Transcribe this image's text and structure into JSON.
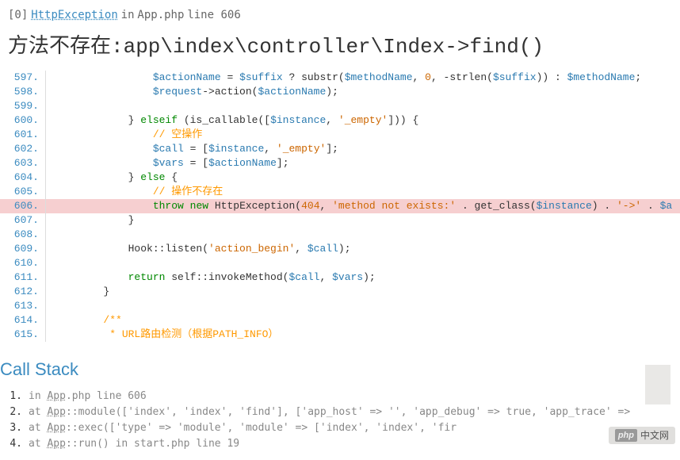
{
  "header": {
    "index": "[0]",
    "exception_class": "HttpException",
    "in": "in",
    "file": "App.php",
    "line_text": "line 606"
  },
  "title": "方法不存在:app\\index\\controller\\Index->find()",
  "code": {
    "lines": [
      {
        "n": "597.",
        "html": "                <span class='php-var'>$actionName</span> = <span class='php-var'>$suffix</span> ? substr(<span class='php-var'>$methodName</span>, <span class='php-number'>0</span>, -strlen(<span class='php-var'>$suffix</span>)) : <span class='php-var'>$methodName</span>;"
      },
      {
        "n": "598.",
        "html": "                <span class='php-var'>$request</span>-&gt;action(<span class='php-var'>$actionName</span>);"
      },
      {
        "n": "599.",
        "html": ""
      },
      {
        "n": "600.",
        "html": "            } <span class='php-keyword'>elseif</span> (is_callable([<span class='php-var'>$instance</span>, <span class='php-string'>'_empty'</span>])) {"
      },
      {
        "n": "601.",
        "html": "                <span class='php-comment'>// 空操作</span>"
      },
      {
        "n": "602.",
        "html": "                <span class='php-var'>$call</span> = [<span class='php-var'>$instance</span>, <span class='php-string'>'_empty'</span>];"
      },
      {
        "n": "603.",
        "html": "                <span class='php-var'>$vars</span> = [<span class='php-var'>$actionName</span>];"
      },
      {
        "n": "604.",
        "html": "            } <span class='php-keyword'>else</span> {"
      },
      {
        "n": "605.",
        "html": "                <span class='php-comment'>// 操作不存在</span>"
      },
      {
        "n": "606.",
        "hl": true,
        "html": "                <span class='php-keyword'>throw</span> <span class='php-keyword'>new</span> HttpException(<span class='php-number'>404</span>, <span class='php-string'>'method not exists:'</span> . get_class(<span class='php-var'>$instance</span>) . <span class='php-string'>'-&gt;'</span> . <span class='php-var'>$a</span>"
      },
      {
        "n": "607.",
        "html": "            }"
      },
      {
        "n": "608.",
        "html": ""
      },
      {
        "n": "609.",
        "html": "            Hook::listen(<span class='php-string'>'action_begin'</span>, <span class='php-var'>$call</span>);"
      },
      {
        "n": "610.",
        "html": ""
      },
      {
        "n": "611.",
        "html": "            <span class='php-keyword'>return</span> self::invokeMethod(<span class='php-var'>$call</span>, <span class='php-var'>$vars</span>);"
      },
      {
        "n": "612.",
        "html": "        }"
      },
      {
        "n": "613.",
        "html": ""
      },
      {
        "n": "614.",
        "html": "        <span class='php-comment'>/**</span>"
      },
      {
        "n": "615.",
        "html": "<span class='php-comment'>         * URL路由检测（根据PATH_INFO）</span>"
      }
    ]
  },
  "call_stack_title": "Call Stack",
  "stack": [
    {
      "n": "1.",
      "text": "in App.php line 606"
    },
    {
      "n": "2.",
      "text": "at App::module(['index', 'index', 'find'], ['app_host' => '', 'app_debug' => true, 'app_trace' =>"
    },
    {
      "n": "3.",
      "text": "at App::exec(['type' => 'module', 'module' => ['index', 'index', 'fir"
    },
    {
      "n": "4.",
      "text": "at App::run() in start.php line 19"
    }
  ],
  "brand": {
    "php": "php",
    "name": "中文网"
  }
}
